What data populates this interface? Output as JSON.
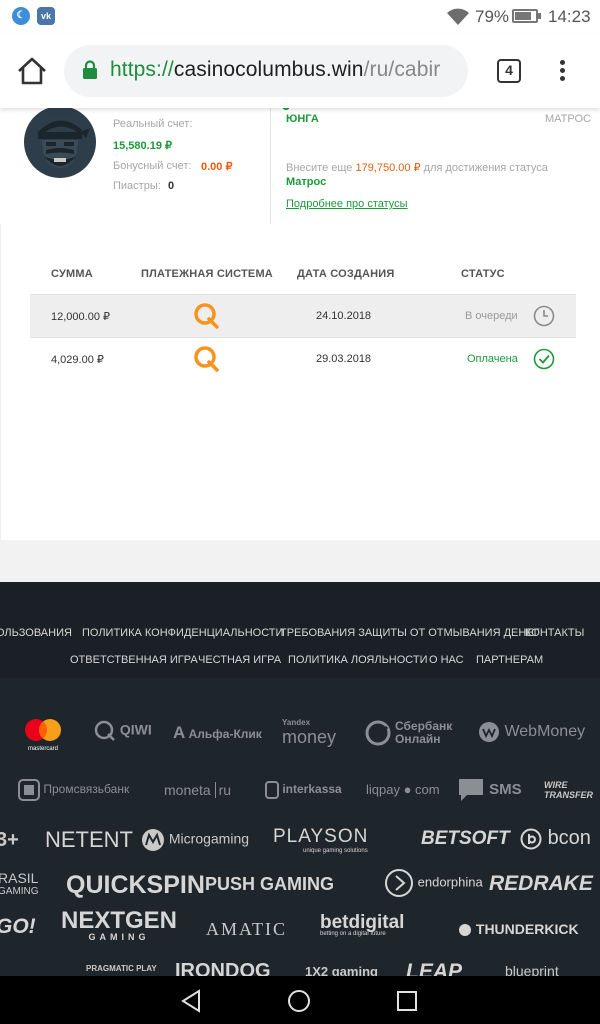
{
  "status_bar": {
    "battery": "79%",
    "battery_level": 0.79,
    "time": "14:23",
    "icons": [
      "moon-app-icon",
      "vk-app-icon",
      "wifi-icon",
      "battery-icon"
    ]
  },
  "browser": {
    "url_scheme": "https://",
    "url_host": "casinocolumbus.win",
    "url_path": "/ru/cabir",
    "tabs_count": "4"
  },
  "profile": {
    "real_label": "Реальный счет:",
    "real_value": "15,580.19 ₽",
    "bonus_label": "Бонусный счет:",
    "bonus_value": "0.00 ₽",
    "piastres_label": "Пиастры:",
    "piastres_value": "0",
    "status_current": "ЮНГА",
    "status_next": "МАТРОС",
    "progress_prefix": "Внесите еще ",
    "progress_amount": "179,750.00 ₽",
    "progress_suffix": " для достижения статуса",
    "progress_target": "Матрос",
    "status_link": "Подробнее про статусы"
  },
  "transactions": {
    "headers": [
      "СУММА",
      "ПЛАТЕЖНАЯ СИСТЕМА",
      "ДАТА СОЗДАНИЯ",
      "СТАТУС"
    ],
    "rows": [
      {
        "amount": "12,000.00 ₽",
        "system": "qiwi",
        "date": "24.10.2018",
        "status": "В очереди",
        "status_color": "#9a9a9a",
        "icon": "clock-icon"
      },
      {
        "amount": "4,029.00 ₽",
        "system": "qiwi",
        "date": "29.03.2018",
        "status": "Оплачена",
        "status_color": "#1c9a3a",
        "icon": "check-circle-icon"
      }
    ]
  },
  "footer": {
    "links_row1": [
      "ОЛЬЗОВАНИЯ",
      "ПОЛИТИКА КОНФИДЕНЦИАЛЬНОСТИ",
      "ТРЕБОВАНИЯ ЗАЩИТЫ ОТ ОТМЫВАНИЯ ДЕНЕГ",
      "КОНТАКТЫ"
    ],
    "links_row2": [
      "ОТВЕТСТВЕННАЯ ИГРА",
      "ЧЕСТНАЯ ИГРА",
      "ПОЛИТИКА ЛОЯЛЬНОСТИ",
      "О НАС",
      "ПАРТНЕРАМ"
    ],
    "payment_logos": {
      "mastercard": "mastercard",
      "qiwi": "QIWI",
      "alfa": "Альфа-Клик",
      "yandex_top": "Yandex",
      "yandex_bottom": "money",
      "sber_top": "Сбербанк",
      "sber_bottom": "Онлайн",
      "webmoney": "WebMoney",
      "psb": "Промсвязьбанк",
      "moneta": "moneta",
      "moneta_ru": "ru",
      "interkassa": "interkassa",
      "liqpay": "liqpay",
      "liqpay_com": "com",
      "sms": "SMS",
      "wire": "WIRE TRANSFER"
    },
    "provider_logos": {
      "row1": [
        "3+",
        "NETENT",
        "Microgaming",
        "PLAYSON",
        "BETSOFT",
        "bcon"
      ],
      "playson_sub": "unique gaming solutions",
      "row2": [
        "RASIL",
        "QUICKSPIN",
        "PUSH GAMING",
        "endorphina",
        "REDRAKE"
      ],
      "rasil_sub": "GAMING",
      "row3": [
        "GO!",
        "NEXTGEN",
        "AMATIC",
        "betdigital",
        "THUNDERKICK"
      ],
      "nextgen_sub": "GAMING",
      "betdigital_sub": "betting on a digital future",
      "row4": [
        "PRAGMATIC PLAY",
        "IRONDOG",
        "1X2 gaming",
        "LEAP",
        "blueprint"
      ]
    }
  }
}
